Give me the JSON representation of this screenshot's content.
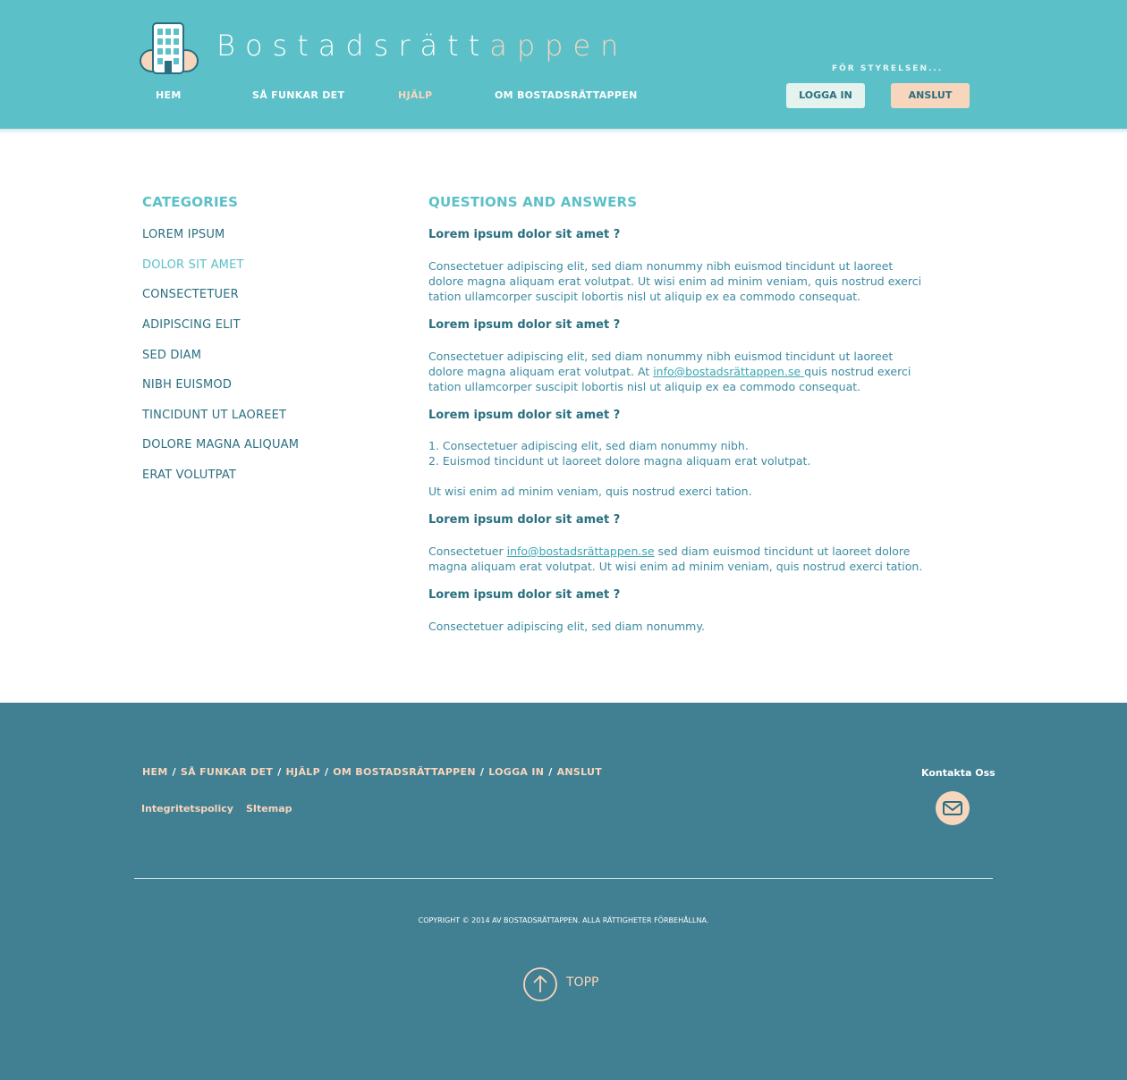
{
  "header": {
    "brand_main": "Bostadsrätt",
    "brand_accent": "appen",
    "nav": [
      "HEM",
      "SÅ FUNKAR DET",
      "HJÄLP",
      "OM BOSTADSRÄTTAPPEN"
    ],
    "active_nav": "HJÄLP",
    "for_board": "FÖR STYRELSEN...",
    "login_label": "LOGGA IN",
    "join_label": "ANSLUT"
  },
  "categories": {
    "title": "CATEGORIES",
    "items": [
      "LOREM IPSUM",
      "DOLOR SIT AMET",
      "CONSECTETUER",
      "ADIPISCING ELIT",
      "SED DIAM",
      "NIBH EUISMOD",
      "TINCIDUNT UT LAOREET",
      "DOLORE MAGNA ALIQUAM",
      "ERAT VOLUTPAT"
    ],
    "active": "DOLOR SIT AMET"
  },
  "qa": {
    "title": "QUESTIONS AND ANSWERS",
    "q1": "Lorem ipsum dolor sit amet ?",
    "a1_l1": "Consectetuer adipiscing elit, sed diam nonummy nibh euismod tincidunt ut laoreet",
    "a1_l2": "dolore magna aliquam erat volutpat. Ut wisi enim ad minim veniam, quis nostrud exerci",
    "a1_l3": "tation ullamcorper suscipit lobortis nisl ut aliquip ex ea commodo consequat.",
    "q2": "Lorem ipsum dolor sit amet ?",
    "a2_l1": "Consectetuer adipiscing elit, sed diam nonummy nibh euismod tincidunt ut laoreet",
    "a2_l2_pre": "dolore magna aliquam erat volutpat. At ",
    "a2_link": "info@bostadsrättappen.se ",
    "a2_l2_post": "quis nostrud exerci",
    "a2_l3": "tation ullamcorper suscipit lobortis nisl ut aliquip ex ea commodo consequat.",
    "q3": "Lorem ipsum dolor sit amet ?",
    "a3_li1": "1. Consectetuer adipiscing elit, sed diam nonummy nibh.",
    "a3_li2": "2. Euismod tincidunt ut laoreet dolore magna aliquam erat volutpat.",
    "a3_extra": "Ut wisi enim ad minim veniam, quis nostrud exerci tation.",
    "q4": "Lorem ipsum dolor sit amet ?",
    "a4_pre": "Consectetuer ",
    "a4_link": "info@bostadsrättappen.se",
    "a4_post": " sed diam euismod tincidunt ut laoreet dolore",
    "a4_l2": "magna aliquam erat volutpat. Ut wisi enim ad minim veniam, quis nostrud exerci tation.",
    "q5": "Lorem ipsum dolor sit amet ?",
    "a5": "Consectetuer adipiscing elit, sed diam nonummy."
  },
  "footer": {
    "nav": [
      "HEM",
      "SÅ FUNKAR DET",
      "HJÄLP",
      "OM BOSTADSRÄTTAPPEN",
      "LOGGA IN",
      "ANSLUT"
    ],
    "separator": "/",
    "privacy": "Integritetspolicy",
    "sitemap": "SItemap",
    "contact": "Kontakta Oss",
    "copyright": "COPYRIGHT © 2014 AV BOSTADSRÄTTAPPEN. ALLA RÄTTIGHETER FÖRBEHÅLLNA.",
    "top_label": "TOPP"
  },
  "colors": {
    "header_bg": "#5bc0c8",
    "footer_bg": "#417f92",
    "accent_peach": "#f8d6bd",
    "text_dark": "#2a6f80"
  }
}
